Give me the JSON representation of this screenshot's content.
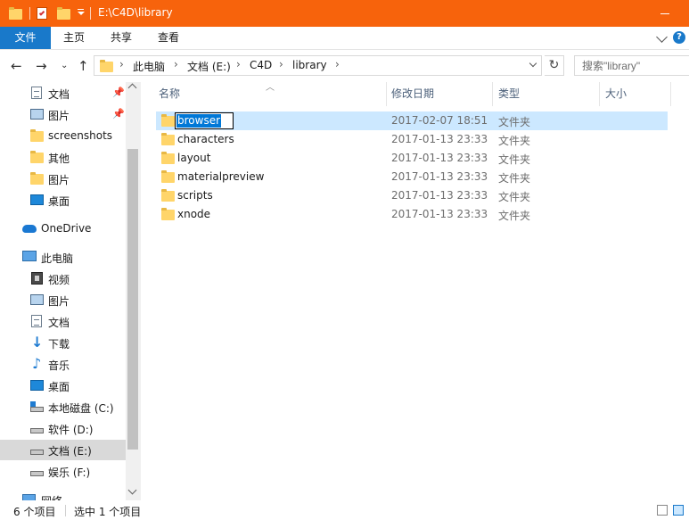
{
  "window": {
    "title": "E:\\C4D\\library",
    "accent_color": "#f7630c"
  },
  "ribbon": {
    "tabs": [
      "文件",
      "主页",
      "共享",
      "查看"
    ],
    "active_tab_color": "#1979ca"
  },
  "address_bar": {
    "breadcrumbs": [
      "此电脑",
      "文档 (E:)",
      "C4D",
      "library"
    ],
    "search_placeholder": "搜索\"library\""
  },
  "sidebar": {
    "items": [
      {
        "label": "文档",
        "icon": "document-icon",
        "pinned": true
      },
      {
        "label": "图片",
        "icon": "picture-icon",
        "pinned": true
      },
      {
        "label": "screenshots",
        "icon": "folder-icon"
      },
      {
        "label": "其他",
        "icon": "folder-icon"
      },
      {
        "label": "图片",
        "icon": "folder-icon"
      },
      {
        "label": "桌面",
        "icon": "desktop-icon"
      },
      {
        "label": "OneDrive",
        "icon": "onedrive-cloud-icon"
      },
      {
        "label": "此电脑",
        "icon": "this-pc-icon"
      },
      {
        "label": "视频",
        "icon": "video-icon"
      },
      {
        "label": "图片",
        "icon": "picture-icon"
      },
      {
        "label": "文档",
        "icon": "document-icon"
      },
      {
        "label": "下载",
        "icon": "download-icon"
      },
      {
        "label": "音乐",
        "icon": "music-icon"
      },
      {
        "label": "桌面",
        "icon": "desktop-icon"
      },
      {
        "label": "本地磁盘 (C:)",
        "icon": "system-drive-icon"
      },
      {
        "label": "软件 (D:)",
        "icon": "drive-icon"
      },
      {
        "label": "文档 (E:)",
        "icon": "drive-icon",
        "selected": true
      },
      {
        "label": "娱乐 (F:)",
        "icon": "drive-icon"
      },
      {
        "label": "网络",
        "icon": "network-icon"
      }
    ]
  },
  "file_list": {
    "columns": [
      "名称",
      "修改日期",
      "类型",
      "大小"
    ],
    "rows": [
      {
        "name": "browser",
        "modified": "2017-02-07 18:51",
        "type": "文件夹",
        "selected": true,
        "renaming": true
      },
      {
        "name": "characters",
        "modified": "2017-01-13 23:33",
        "type": "文件夹"
      },
      {
        "name": "layout",
        "modified": "2017-01-13 23:33",
        "type": "文件夹"
      },
      {
        "name": "materialpreview",
        "modified": "2017-01-13 23:33",
        "type": "文件夹"
      },
      {
        "name": "scripts",
        "modified": "2017-01-13 23:33",
        "type": "文件夹"
      },
      {
        "name": "xnode",
        "modified": "2017-01-13 23:33",
        "type": "文件夹"
      }
    ],
    "selection_color": "#cce8ff"
  },
  "status_bar": {
    "item_count": "6 个项目",
    "selected_count": "选中 1 个项目"
  }
}
